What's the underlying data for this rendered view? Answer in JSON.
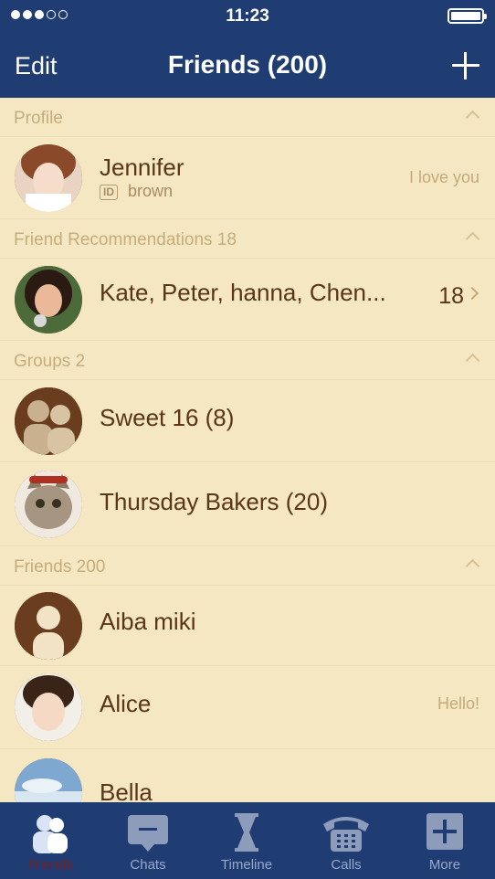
{
  "status_bar": {
    "time": "11:23"
  },
  "nav": {
    "edit_label": "Edit",
    "title": "Friends (200)",
    "add_icon": "plus-icon"
  },
  "sections": {
    "profile": {
      "label": "Profile",
      "name": "Jennifer",
      "id_badge": "ID",
      "id_value": "brown",
      "status": "I love you"
    },
    "recommendations": {
      "label": "Friend Recommendations 18",
      "names": "Kate, Peter, hanna, Chen...",
      "count": "18"
    },
    "groups": {
      "label": "Groups 2",
      "items": [
        {
          "name": "Sweet 16 (8)"
        },
        {
          "name": "Thursday Bakers (20)"
        }
      ]
    },
    "friends": {
      "label": "Friends 200",
      "items": [
        {
          "name": "Aiba miki",
          "status": ""
        },
        {
          "name": "Alice",
          "status": "Hello!"
        },
        {
          "name": "Bella",
          "status": ""
        }
      ]
    }
  },
  "tabbar": {
    "items": [
      {
        "label": "Friends",
        "icon": "friends-icon",
        "active": true
      },
      {
        "label": "Chats",
        "icon": "chat-icon",
        "active": false
      },
      {
        "label": "Timeline",
        "icon": "hourglass-icon",
        "active": false
      },
      {
        "label": "Calls",
        "icon": "phone-icon",
        "active": false
      },
      {
        "label": "More",
        "icon": "plus-square-icon",
        "active": false
      }
    ]
  },
  "colors": {
    "header_bg": "#1f3c73",
    "list_bg": "#f6e7c3",
    "name_text": "#5a3517",
    "section_text": "#c6ac7a",
    "active_tab": "#7a2020"
  }
}
